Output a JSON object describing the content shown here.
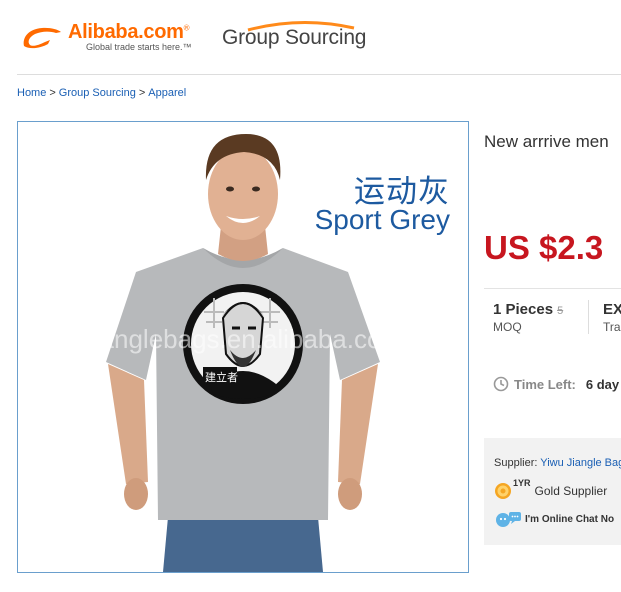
{
  "header": {
    "logo_text": "Alibaba.com",
    "logo_reg": "®",
    "logo_tagline": "Global trade starts here.™",
    "section_title": "Group Sourcing"
  },
  "breadcrumb": {
    "items": [
      "Home",
      "Group Sourcing",
      "Apparel"
    ],
    "separator": ">"
  },
  "product_image": {
    "cn_label": "运动灰",
    "en_label": "Sport Grey",
    "badge_text": "建立者",
    "watermark": "jianglebags.en.alibaba.com"
  },
  "product": {
    "title": "New arrrive men",
    "price": "US $2.3",
    "moq_value": "1 Pieces",
    "moq_strike": "5",
    "moq_label": "MOQ",
    "ex_value": "EX",
    "ex_label": "Tra",
    "time_left_label": "Time Left:",
    "time_left_value": "6 day"
  },
  "supplier": {
    "label": "Supplier:",
    "name": "Yiwu Jiangle Bag",
    "years": "1YR",
    "gold_label": "Gold Supplier",
    "chat_label": "I'm Online Chat No"
  },
  "colors": {
    "brand_orange": "#ff6a00",
    "link_blue": "#1a5fb4",
    "price_red": "#c7161f",
    "frame_blue": "#6a9fcd",
    "label_blue": "#1d5aa0"
  },
  "icons": [
    "alibaba-logo-icon",
    "group-sourcing-arc-icon",
    "clock-icon",
    "gold-medal-icon",
    "chat-icon"
  ]
}
